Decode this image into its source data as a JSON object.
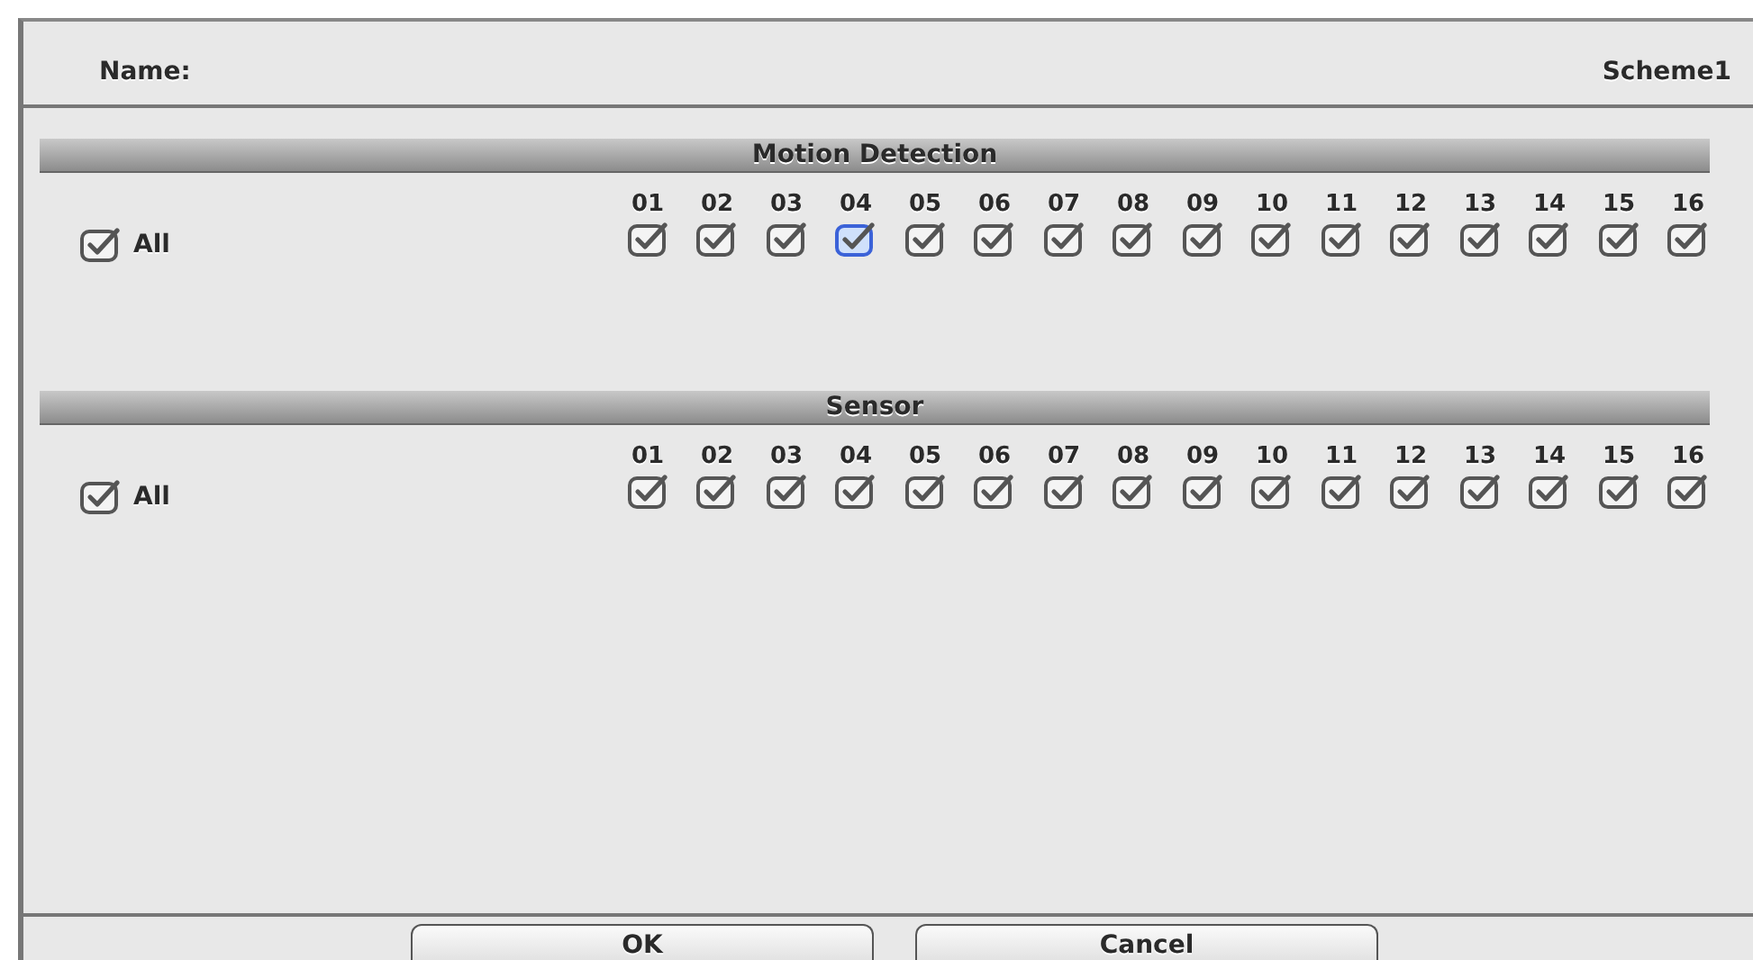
{
  "name_row": {
    "label": "Name:",
    "value": "Scheme1"
  },
  "sections": [
    {
      "title": "Motion Detection",
      "all": {
        "label": "All",
        "checked": true
      },
      "channels": [
        {
          "label": "01",
          "checked": true,
          "focused": false
        },
        {
          "label": "02",
          "checked": true,
          "focused": false
        },
        {
          "label": "03",
          "checked": true,
          "focused": false
        },
        {
          "label": "04",
          "checked": true,
          "focused": true
        },
        {
          "label": "05",
          "checked": true,
          "focused": false
        },
        {
          "label": "06",
          "checked": true,
          "focused": false
        },
        {
          "label": "07",
          "checked": true,
          "focused": false
        },
        {
          "label": "08",
          "checked": true,
          "focused": false
        },
        {
          "label": "09",
          "checked": true,
          "focused": false
        },
        {
          "label": "10",
          "checked": true,
          "focused": false
        },
        {
          "label": "11",
          "checked": true,
          "focused": false
        },
        {
          "label": "12",
          "checked": true,
          "focused": false
        },
        {
          "label": "13",
          "checked": true,
          "focused": false
        },
        {
          "label": "14",
          "checked": true,
          "focused": false
        },
        {
          "label": "15",
          "checked": true,
          "focused": false
        },
        {
          "label": "16",
          "checked": true,
          "focused": false
        }
      ]
    },
    {
      "title": "Sensor",
      "all": {
        "label": "All",
        "checked": true
      },
      "channels": [
        {
          "label": "01",
          "checked": true,
          "focused": false
        },
        {
          "label": "02",
          "checked": true,
          "focused": false
        },
        {
          "label": "03",
          "checked": true,
          "focused": false
        },
        {
          "label": "04",
          "checked": true,
          "focused": false
        },
        {
          "label": "05",
          "checked": true,
          "focused": false
        },
        {
          "label": "06",
          "checked": true,
          "focused": false
        },
        {
          "label": "07",
          "checked": true,
          "focused": false
        },
        {
          "label": "08",
          "checked": true,
          "focused": false
        },
        {
          "label": "09",
          "checked": true,
          "focused": false
        },
        {
          "label": "10",
          "checked": true,
          "focused": false
        },
        {
          "label": "11",
          "checked": true,
          "focused": false
        },
        {
          "label": "12",
          "checked": true,
          "focused": false
        },
        {
          "label": "13",
          "checked": true,
          "focused": false
        },
        {
          "label": "14",
          "checked": true,
          "focused": false
        },
        {
          "label": "15",
          "checked": true,
          "focused": false
        },
        {
          "label": "16",
          "checked": true,
          "focused": false
        }
      ]
    }
  ],
  "buttons": [
    "OK",
    "Cancel"
  ]
}
